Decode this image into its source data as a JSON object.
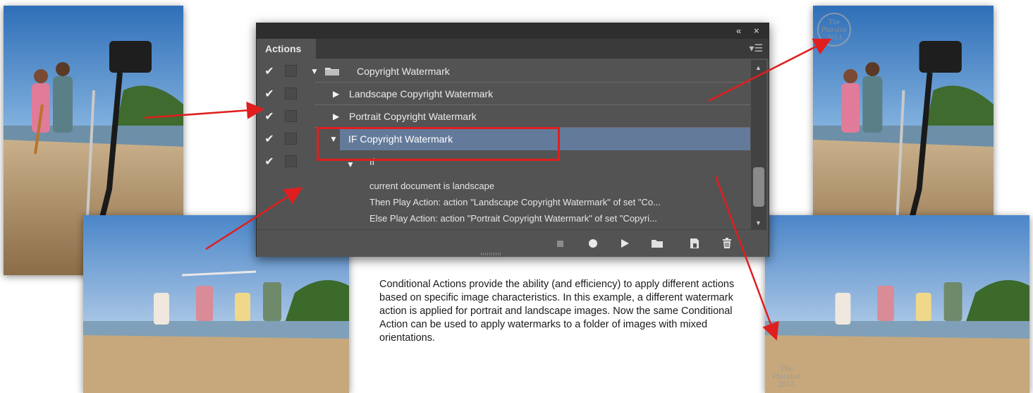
{
  "panel": {
    "tab_label": "Actions",
    "title_controls": [
      "«",
      "×"
    ],
    "menu_icon": "panel-menu-icon",
    "rows": [
      {
        "label": "Copyright Watermark",
        "checked": true,
        "expanded": true,
        "folder": true
      },
      {
        "label": "Landscape Copyright Watermark",
        "checked": true,
        "expanded": false
      },
      {
        "label": "Portrait Copyright Watermark",
        "checked": true,
        "expanded": false
      },
      {
        "label": "IF Copyright Watermark",
        "checked": true,
        "expanded": true,
        "selected": true
      },
      {
        "label": "If",
        "checked": true,
        "expanded": true
      }
    ],
    "condition_lines": [
      "current document is landscape",
      "Then Play Action: action \"Landscape Copyright Watermark\" of set \"Co...",
      "Else Play Action: action \"Portrait Copyright Watermark\" of set \"Copyri..."
    ],
    "toolbar_icons": [
      "stop-icon",
      "record-icon",
      "play-icon",
      "folder-icon",
      "new-action-icon",
      "trash-icon"
    ],
    "highlight_color": "#637a9a",
    "callout_color": "#e01e1e"
  },
  "watermark": {
    "line1": "The",
    "line2": "Pluralist",
    "line3": "2013"
  },
  "caption": "Conditional Actions provide the ability (and efficiency) to apply different actions based on specific image characteristics. In this example, a different watermark action is applied for portrait and landscape images. Now the same Conditional Action can be used to apply watermarks to a folder of images with mixed orientations."
}
